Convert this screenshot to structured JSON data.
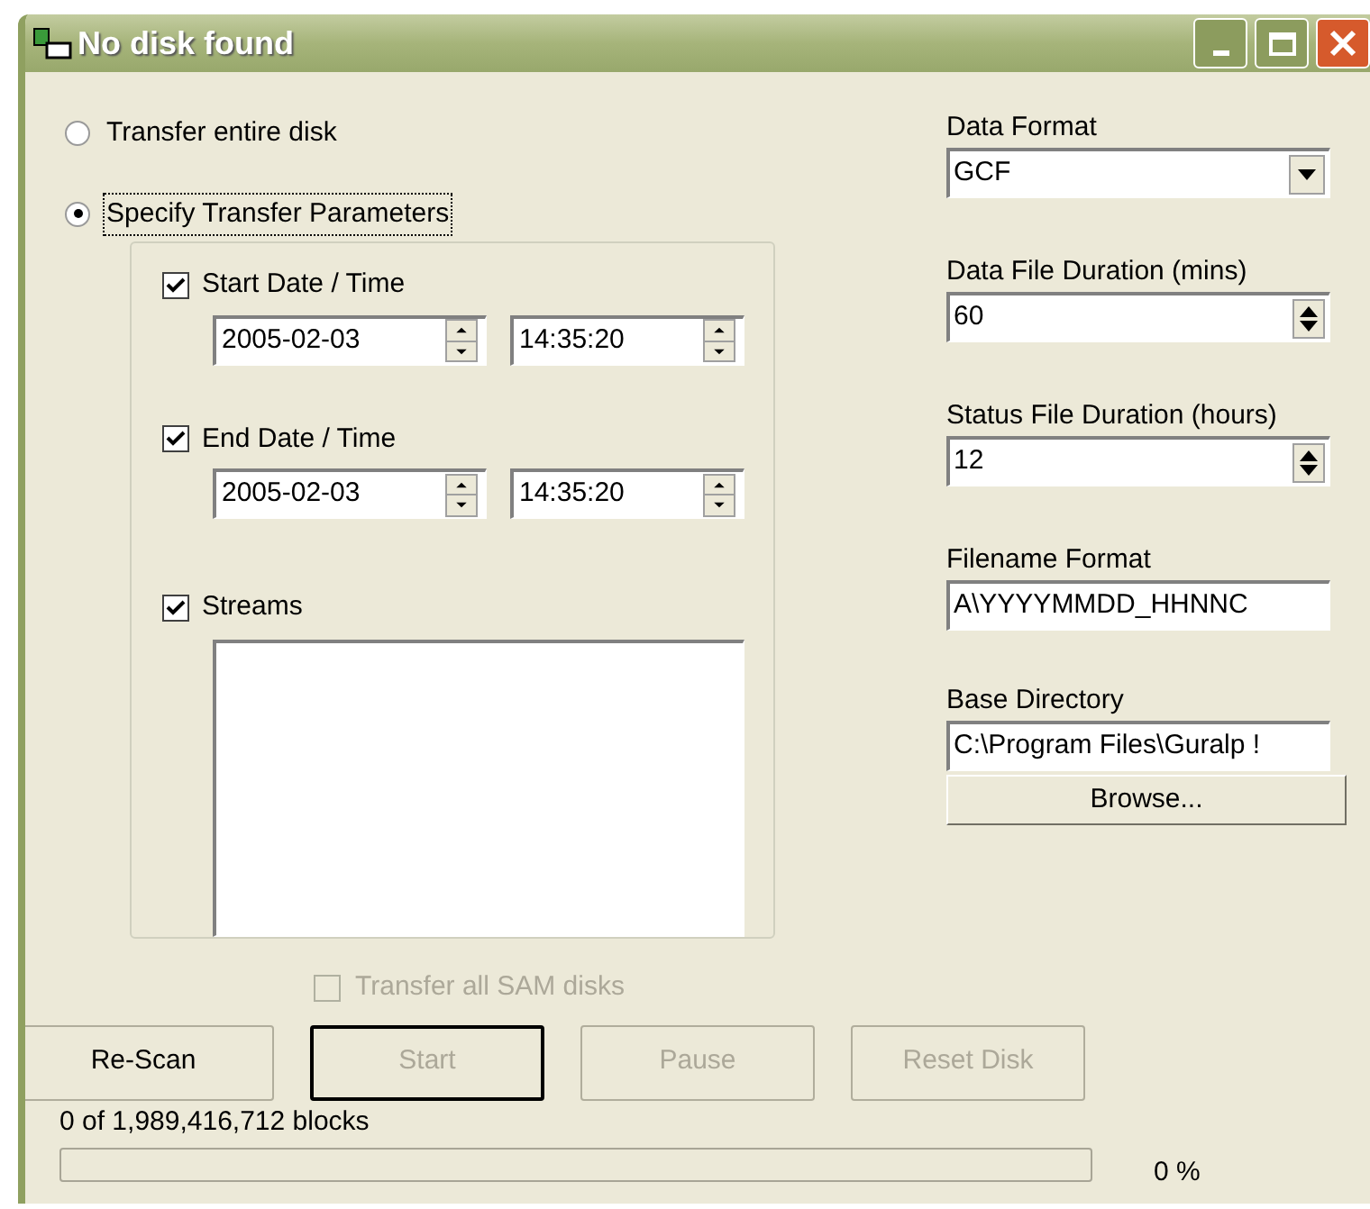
{
  "window": {
    "title": "No disk found"
  },
  "transfer_mode": [
    {
      "label": "Transfer entire disk",
      "selected": false
    },
    {
      "label": "Specify Transfer Parameters",
      "selected": true
    }
  ],
  "parameters": {
    "start": {
      "label": "Start Date / Time",
      "checked": true,
      "date": "2005-02-03",
      "time": "14:35:20"
    },
    "end": {
      "label": "End Date / Time",
      "checked": true,
      "date": "2005-02-03",
      "time": "14:35:20"
    },
    "streams": {
      "label": "Streams",
      "checked": true
    }
  },
  "transfer_all_sam": {
    "label": "Transfer all SAM disks",
    "checked": false,
    "disabled": true
  },
  "settings": [
    {
      "kind": "combo",
      "label": "Data Format",
      "value": "GCF"
    },
    {
      "kind": "spin",
      "label": "Data File Duration (mins)",
      "value": "60"
    },
    {
      "kind": "spin",
      "label": "Status File Duration (hours)",
      "value": "12"
    },
    {
      "kind": "text",
      "label": "Filename Format",
      "value": "A\\YYYYMMDD_HHNNC"
    },
    {
      "kind": "text",
      "label": "Base Directory",
      "value": "C:\\Program Files\\Guralp !"
    }
  ],
  "browse_button": "Browse...",
  "buttons": [
    {
      "label": "Re-Scan",
      "disabled": false,
      "default": false
    },
    {
      "label": "Start",
      "disabled": true,
      "default": true
    },
    {
      "label": "Pause",
      "disabled": true,
      "default": false
    },
    {
      "label": "Reset Disk",
      "disabled": true,
      "default": false
    }
  ],
  "progress": {
    "text": "0 of 1,989,416,712 blocks",
    "level": 0,
    "percent": "0 %"
  }
}
